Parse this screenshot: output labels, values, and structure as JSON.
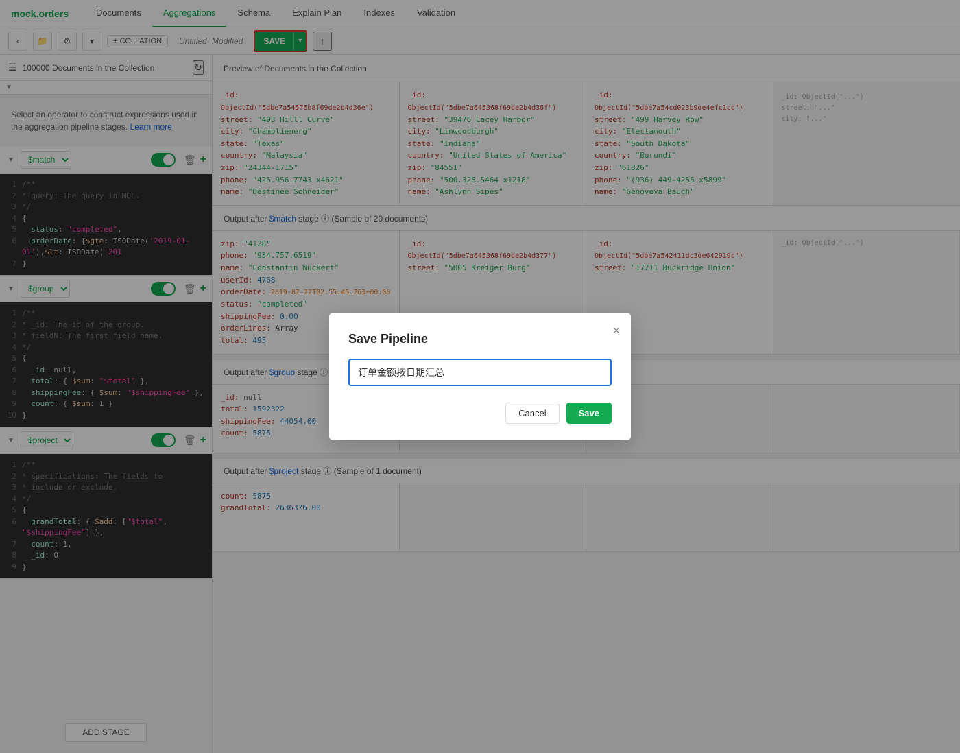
{
  "app": {
    "logo_text": "mock.",
    "logo_accent": "orders"
  },
  "nav": {
    "tabs": [
      {
        "id": "documents",
        "label": "Documents",
        "active": false
      },
      {
        "id": "aggregations",
        "label": "Aggregations",
        "active": true
      },
      {
        "id": "schema",
        "label": "Schema",
        "active": false
      },
      {
        "id": "explain-plan",
        "label": "Explain Plan",
        "active": false
      },
      {
        "id": "indexes",
        "label": "Indexes",
        "active": false
      },
      {
        "id": "validation",
        "label": "Validation",
        "active": false
      }
    ]
  },
  "toolbar": {
    "collation_label": "+ COLLATION",
    "pipeline_name": "Untitled· Modified",
    "save_label": "SAVE",
    "dropdown_char": "▾",
    "export_icon": "↑"
  },
  "left_panel": {
    "docs_count": "100000 Documents in the Collection",
    "operator_text": "Select an operator to construct expressions used in the aggregation pipeline stages.",
    "learn_more": "Learn more"
  },
  "preview": {
    "header_text": "Preview of Documents in the Collection",
    "docs": [
      {
        "_id": "ObjectId(\"5dbe7a54576b8f69de2b4d36e\")",
        "street": "\"493 Hilll Curve\"",
        "city": "\"Champlienerg\"",
        "state": "\"Texas\"",
        "country": "\"Malaysia\"",
        "zip": "\"24344-1715\"",
        "phone": "\"425.956.7743 x4621\"",
        "name": "\"Destinee Schneider\""
      },
      {
        "_id": "ObjectId(\"5dbe7a645368f69de2b4d36f\")",
        "street": "\"39476 Lacey Harbor\"",
        "city": "\"Linwoodburgh\"",
        "state": "\"Indiana\"",
        "country": "\"United States of America\"",
        "zip": "\"84551\"",
        "phone": "\"500.326.5464 x1218\"",
        "name": "\"Ashlynn Sipes\""
      },
      {
        "_id": "ObjectId(\"5dbe7a54cd023b9de4efc1cc\")",
        "street": "\"499 Harvey Row\"",
        "city": "\"Electamouth\"",
        "state": "\"South Dakota\"",
        "country": "\"Burundi\"",
        "zip": "\"61826\"",
        "phone": "\"(936) 449-4255 x5899\"",
        "name": "\"Genoveva Bauch\""
      }
    ]
  },
  "stages": [
    {
      "id": "match",
      "operator": "$match",
      "enabled": true,
      "output_header": "Output after $match stage ⓘ (Sample of 20 documents)",
      "code": [
        {
          "ln": "1",
          "text": "/**",
          "type": "comment"
        },
        {
          "ln": "2",
          "text": " * query: The query in MQL.",
          "type": "comment"
        },
        {
          "ln": "3",
          "text": " */",
          "type": "comment"
        },
        {
          "ln": "4",
          "text": "{",
          "type": "bracket"
        },
        {
          "ln": "5",
          "text": "  status: \"completed\",",
          "type": "code"
        },
        {
          "ln": "6",
          "text": "  orderDate: {$gte: ISODate('2019-01-01'), $lt: ISODate('201",
          "type": "code"
        },
        {
          "ln": "7",
          "text": "}",
          "type": "bracket"
        }
      ],
      "output_docs": [
        {
          "zip": "\"4128\"",
          "phone": "\"934.757.6519\"",
          "name": "\"Constantin Wuckert\"",
          "userId": "4768",
          "orderDate": "2019-02-22T02:55:45.263+00:00",
          "status": "\"completed\"",
          "shippingFee": "0.00",
          "orderLines": "Array",
          "total": "495"
        },
        {
          "_id": "ObjectId(\"5dbe7a645368f69de2b4d377\")",
          "street": "\"5805 Kreiger Burg\""
        },
        {
          "_id": "ObjectId(\"5dbe7a542411dc3de642919c\")",
          "street": "\"17711 Buckridge Union\""
        }
      ]
    },
    {
      "id": "group",
      "operator": "$group",
      "enabled": true,
      "output_header": "Output after $group stage ⓘ (Sample of 1 document)",
      "code": [
        {
          "ln": "1",
          "text": "/**",
          "type": "comment"
        },
        {
          "ln": "2",
          "text": " * _id: The id of the group.",
          "type": "comment"
        },
        {
          "ln": "3",
          "text": " * fieldN: The first field name.",
          "type": "comment"
        },
        {
          "ln": "4",
          "text": " */",
          "type": "comment"
        },
        {
          "ln": "5",
          "text": "{",
          "type": "bracket"
        },
        {
          "ln": "6",
          "text": "  _id: null,",
          "type": "code"
        },
        {
          "ln": "7",
          "text": "  total: { $sum: \"$total\" },",
          "type": "code"
        },
        {
          "ln": "8",
          "text": "  shippingFee: { $sum: \"$shippingFee\" },",
          "type": "code"
        },
        {
          "ln": "9",
          "text": "  count: { $sum: 1 }",
          "type": "code"
        },
        {
          "ln": "10",
          "text": "}",
          "type": "bracket"
        }
      ],
      "output_docs": [
        {
          "_id": "null",
          "total": "1592322",
          "shippingFee": "44054.00",
          "count": "5875"
        }
      ]
    },
    {
      "id": "project",
      "operator": "$project",
      "enabled": true,
      "output_header": "Output after $project stage ⓘ (Sample of 1 document)",
      "code": [
        {
          "ln": "1",
          "text": "/**",
          "type": "comment"
        },
        {
          "ln": "2",
          "text": " * specifications: The fields to",
          "type": "comment"
        },
        {
          "ln": "3",
          "text": " *   include or exclude.",
          "type": "comment"
        },
        {
          "ln": "4",
          "text": " */",
          "type": "comment"
        },
        {
          "ln": "5",
          "text": "{",
          "type": "bracket"
        },
        {
          "ln": "6",
          "text": "  grandTotal: { $add: [\"$total\", \"$shippingFee\"] },",
          "type": "code"
        },
        {
          "ln": "7",
          "text": "  count: 1,",
          "type": "code"
        },
        {
          "ln": "8",
          "text": "  _id: 0",
          "type": "code"
        },
        {
          "ln": "9",
          "text": "}",
          "type": "bracket"
        }
      ],
      "output_docs": [
        {
          "count": "5875",
          "grandTotal": "2636376.00"
        }
      ]
    }
  ],
  "modal": {
    "title": "Save Pipeline",
    "input_value": "订单金额按日期汇总",
    "cancel_label": "Cancel",
    "save_label": "Save",
    "close_icon": "×"
  },
  "footer": {
    "add_stage_label": "ADD STAGE"
  }
}
